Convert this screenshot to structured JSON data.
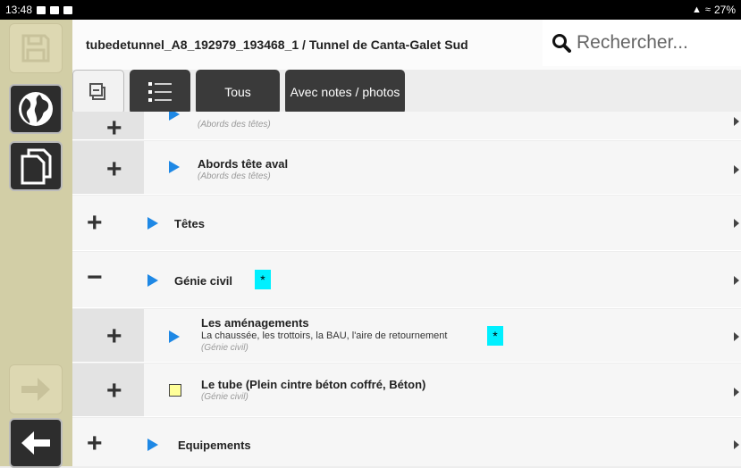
{
  "status_bar": {
    "time": "13:48",
    "battery": "27%"
  },
  "header": {
    "title": "tubedetunnel_A8_192979_193468_1 / Tunnel de Canta-Galet Sud"
  },
  "search": {
    "placeholder": "Rechercher..."
  },
  "toolbar": {
    "tous_label": "Tous",
    "notes_label": "Avec notes / photos"
  },
  "rows": [
    {
      "expander": "+",
      "marker": "triangle",
      "title": "",
      "desc": "",
      "category": "(Abords des têtes)",
      "star": ""
    },
    {
      "expander": "+",
      "marker": "triangle",
      "title": "Abords tête aval",
      "desc": "",
      "category": "(Abords des têtes)",
      "star": ""
    },
    {
      "expander": "+",
      "marker": "triangle",
      "title": "Têtes",
      "desc": "",
      "category": "",
      "star": ""
    },
    {
      "expander": "−",
      "marker": "triangle",
      "title": "Génie civil",
      "desc": "",
      "category": "",
      "star": "*"
    },
    {
      "expander": "+",
      "marker": "triangle",
      "title": "Les aménagements",
      "desc": "La chaussée, les trottoirs, la BAU, l'aire de retournement",
      "category": "(Génie civil)",
      "star": "*"
    },
    {
      "expander": "+",
      "marker": "square",
      "title": "Le tube (Plein cintre béton coffré, Béton)",
      "desc": "",
      "category": "(Génie civil)",
      "star": ""
    },
    {
      "expander": "+",
      "marker": "triangle",
      "title": "Equipements",
      "desc": "",
      "category": "",
      "star": ""
    }
  ],
  "colors": {
    "accent_star": "#00f0ff",
    "triangle": "#1e88e5",
    "sidebar": "#d2cea6"
  },
  "icons": [
    "save-icon",
    "globe-icon",
    "copy-icon",
    "arrow-right-icon",
    "arrow-left-icon",
    "search-icon",
    "collapse-icon",
    "list-icon"
  ]
}
